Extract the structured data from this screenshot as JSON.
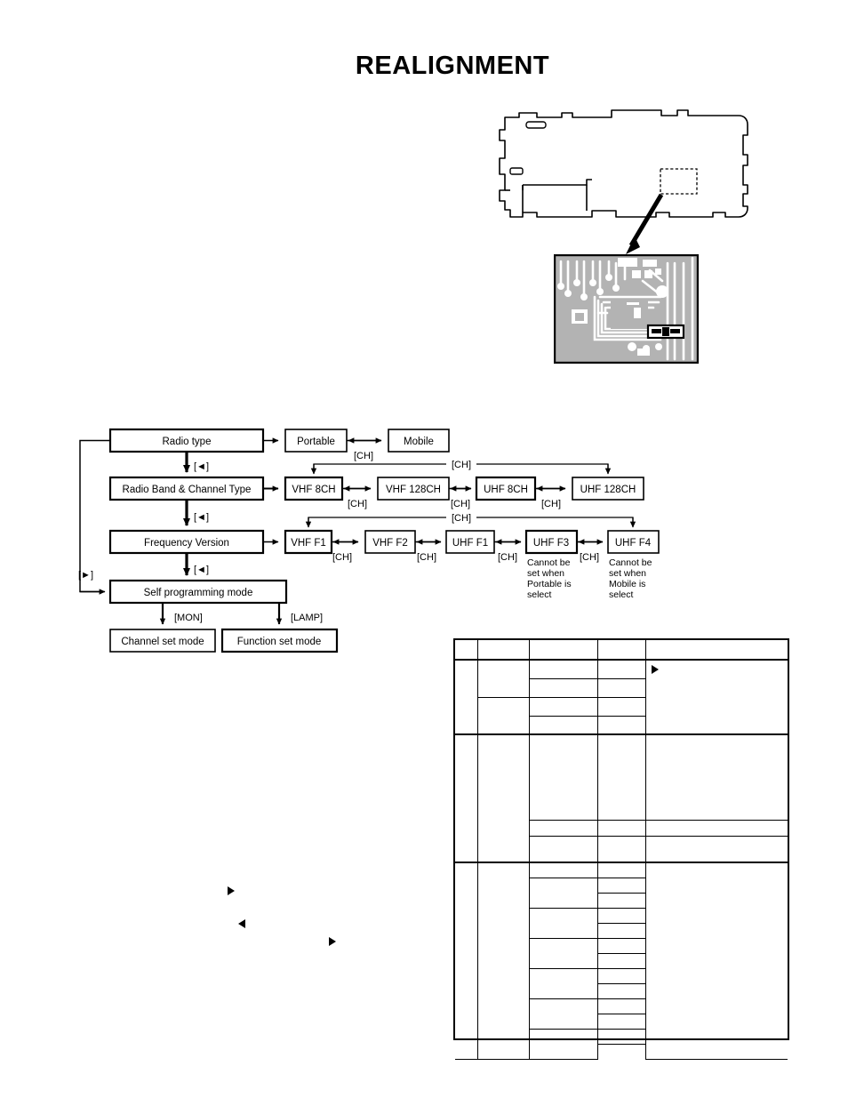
{
  "page": {
    "title": "REALIGNMENT"
  },
  "pcb_figure": {
    "name": "pcb-board-outline",
    "callout_name": "detail-callout-box",
    "arrow_name": "callout-arrow",
    "detail_name": "pcb-detail-view",
    "highlighted_component_name": "highlighted-component"
  },
  "flowchart": {
    "nodes": {
      "radio_type": "Radio type",
      "portable": "Portable",
      "mobile": "Mobile",
      "radio_band_channel_type": "Radio Band & Channel Type",
      "vhf_8ch": "VHF 8CH",
      "vhf_128ch": "VHF 128CH",
      "uhf_8ch": "UHF 8CH",
      "uhf_128ch": "UHF 128CH",
      "frequency_version": "Frequency Version",
      "vhf_f1": "VHF F1",
      "vhf_f2": "VHF F2",
      "uhf_f1": "UHF F1",
      "uhf_f3": "UHF F3",
      "uhf_f4": "UHF F4",
      "self_programming_mode": "Self programming mode",
      "channel_set_mode": "Channel set mode",
      "function_set_mode": "Function set mode"
    },
    "keys": {
      "ch": "[CH]",
      "left": "[◄]",
      "right": "[►]",
      "mon": "[MON]",
      "lamp": "[LAMP]"
    },
    "notes": {
      "uhf_f3_note_line1": "Cannot be",
      "uhf_f3_note_line2": "set when",
      "uhf_f3_note_line3": "Portable is",
      "uhf_f3_note_line4": "select",
      "uhf_f4_note_line1": "Cannot be",
      "uhf_f4_note_line2": "set when",
      "uhf_f4_note_line3": "Mobile is",
      "uhf_f4_note_line4": "select"
    }
  },
  "markers": [
    {
      "name": "marker-triangle-right-1",
      "glyph": "►"
    },
    {
      "name": "marker-triangle-left-1",
      "glyph": "◄"
    },
    {
      "name": "marker-triangle-right-2",
      "glyph": "►"
    }
  ],
  "spec_table": {
    "name": "realignment-spec-table",
    "columns": 5,
    "cells_empty": true,
    "marker_glyph": "►"
  },
  "colors": {
    "ink": "#000000",
    "paper": "#ffffff",
    "pcb_copper": "#b3b3b3",
    "pcb_trace": "#ffffff"
  }
}
